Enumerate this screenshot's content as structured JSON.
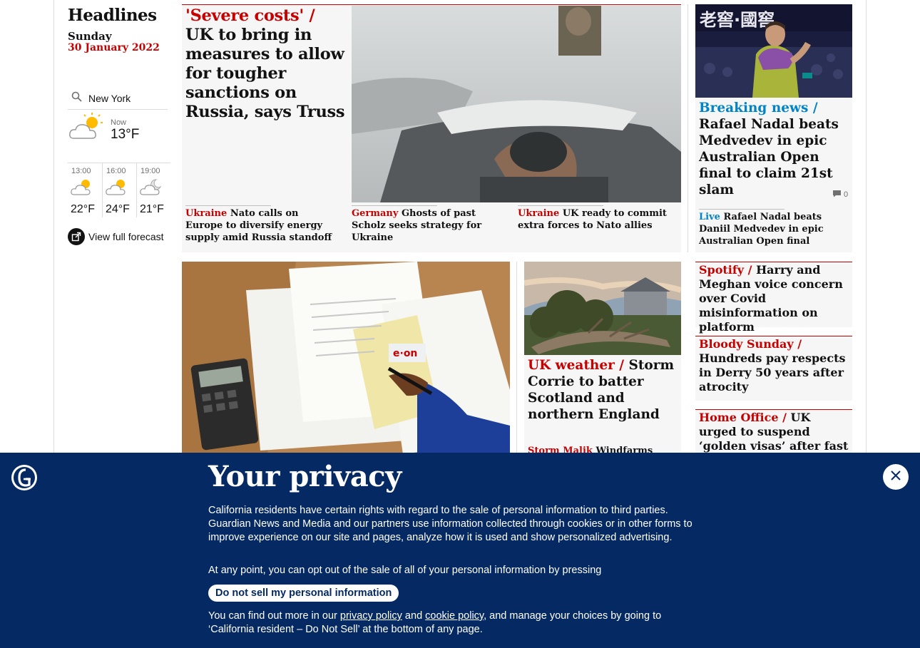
{
  "headlines": {
    "title": "Headlines",
    "day": "Sunday",
    "date": "30 January 2022"
  },
  "weather": {
    "city": "New York",
    "now_label": "Now",
    "now_temp": "13°F",
    "forecast": [
      {
        "time": "13:00",
        "temp": "22°F",
        "icon": "sun-cloud-icon"
      },
      {
        "time": "16:00",
        "temp": "24°F",
        "icon": "sun-cloud-icon"
      },
      {
        "time": "19:00",
        "temp": "21°F",
        "icon": "moon-cloud-icon"
      }
    ],
    "full_forecast": "View full forecast"
  },
  "lead": {
    "kicker": "'Severe costs' /",
    "headline": "UK to bring in measures to allow for tougher sanctions on Russia, says Truss",
    "subs": [
      {
        "kicker": "Ukraine",
        "text": "Nato calls on Europe to diversify energy supply amid Russia standoff"
      },
      {
        "kicker": "Germany",
        "text": "Ghosts of past Scholz seeks strategy for Ukraine"
      },
      {
        "kicker": "Ukraine",
        "text": "UK ready to commit extra forces to Nato allies"
      }
    ]
  },
  "sport": {
    "kicker": "Breaking news /",
    "headline": "Rafael Nadal beats Medvedev in epic Australian Open final to claim 21st slam",
    "comments": "0",
    "sub_kicker": "Live",
    "sub_text": "Rafael Nadal beats Daniil Medvedev in epic Australian Open final"
  },
  "storm": {
    "kicker": "UK weather /",
    "headline": "Storm Corrie to batter Scotland and northern England",
    "sub_kicker": "Storm Malik",
    "sub_text": "Windfarms"
  },
  "side_stories": [
    {
      "kicker": "Spotify /",
      "text": "Harry and Meghan voice concern over Covid misinformation on platform"
    },
    {
      "kicker": "Bloody Sunday /",
      "text": "Hundreds pay respects in Derry 50 years after atrocity"
    },
    {
      "kicker": "Home Office /",
      "text": "UK urged to suspend ‘golden visas’ after fast tracking of Russian"
    }
  ],
  "privacy": {
    "title": "Your privacy",
    "body": "California residents have certain rights with regard to the sale of personal information to third parties. Guardian News and Media and our partners use information collected through cookies or in other forms to improve experience on our site and pages, analyze how it is used and show personalized advertising.",
    "line2": "At any point, you can opt out of the sale of all of your personal information by pressing",
    "button": "Do not sell my personal information",
    "foot_pre": "You can find out more in our ",
    "privacy_link": "privacy policy",
    "and": " and ",
    "cookie_link": "cookie policy",
    "foot_post": ", and manage your choices by going to ‘California resident – Do Not Sell’ at the bottom of any page."
  },
  "colors": {
    "news_red": "#c70000",
    "sport_blue": "#0084c6",
    "banner_navy": "#052962"
  }
}
